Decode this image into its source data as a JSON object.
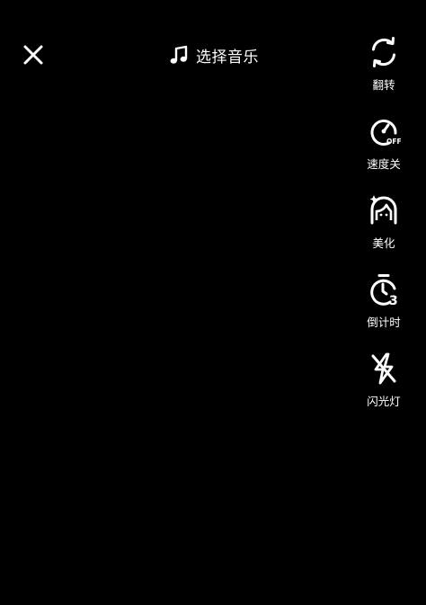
{
  "top_bar": {
    "close_icon": "close-icon",
    "music_icon": "music-note-icon",
    "music_label": "选择音乐"
  },
  "side_tools": [
    {
      "label": "翻转",
      "icon": "flip-camera-icon"
    },
    {
      "label": "速度关",
      "icon": "speed-off-icon"
    },
    {
      "label": "美化",
      "icon": "beautify-icon"
    },
    {
      "label": "倒计时",
      "icon": "countdown-timer-icon"
    },
    {
      "label": "闪光灯",
      "icon": "flash-off-icon"
    }
  ],
  "colors": {
    "background": "#000000",
    "foreground": "#ffffff"
  }
}
